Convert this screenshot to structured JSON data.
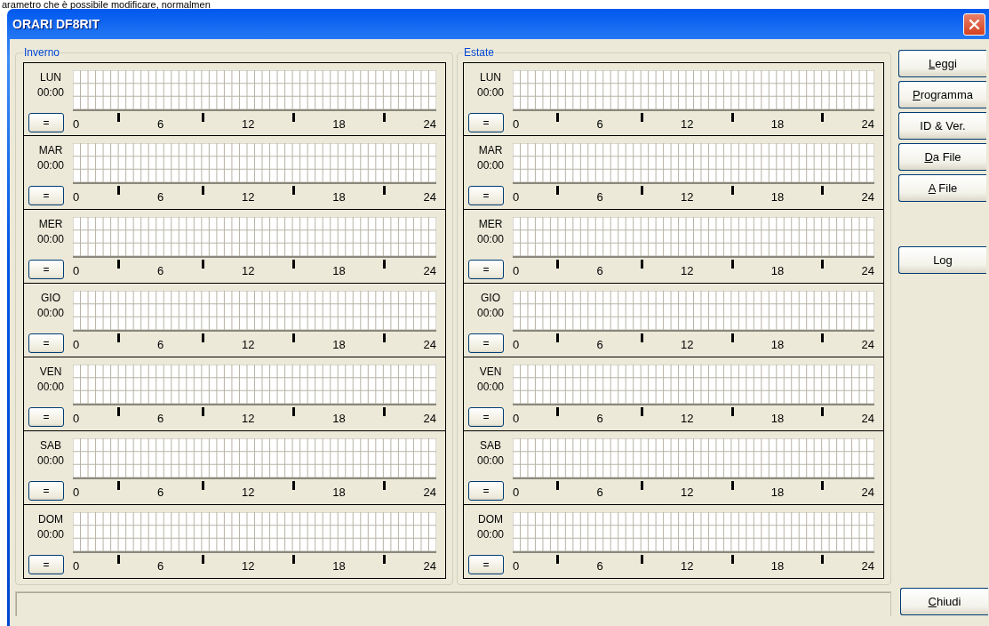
{
  "page_text": "arametro che è possibile modificare, normalmen",
  "window": {
    "title": "ORARI DF8RIT"
  },
  "groups": [
    {
      "title": "Inverno",
      "days": [
        {
          "day": "LUN",
          "time": "00:00",
          "button": "=",
          "scale": [
            "0",
            "6",
            "12",
            "18",
            "24"
          ]
        },
        {
          "day": "MAR",
          "time": "00:00",
          "button": "=",
          "scale": [
            "0",
            "6",
            "12",
            "18",
            "24"
          ]
        },
        {
          "day": "MER",
          "time": "00:00",
          "button": "=",
          "scale": [
            "0",
            "6",
            "12",
            "18",
            "24"
          ]
        },
        {
          "day": "GIO",
          "time": "00:00",
          "button": "=",
          "scale": [
            "0",
            "6",
            "12",
            "18",
            "24"
          ]
        },
        {
          "day": "VEN",
          "time": "00:00",
          "button": "=",
          "scale": [
            "0",
            "6",
            "12",
            "18",
            "24"
          ]
        },
        {
          "day": "SAB",
          "time": "00:00",
          "button": "=",
          "scale": [
            "0",
            "6",
            "12",
            "18",
            "24"
          ]
        },
        {
          "day": "DOM",
          "time": "00:00",
          "button": "=",
          "scale": [
            "0",
            "6",
            "12",
            "18",
            "24"
          ]
        }
      ]
    },
    {
      "title": "Estate",
      "days": [
        {
          "day": "LUN",
          "time": "00:00",
          "button": "=",
          "scale": [
            "0",
            "6",
            "12",
            "18",
            "24"
          ]
        },
        {
          "day": "MAR",
          "time": "00:00",
          "button": "=",
          "scale": [
            "0",
            "6",
            "12",
            "18",
            "24"
          ]
        },
        {
          "day": "MER",
          "time": "00:00",
          "button": "=",
          "scale": [
            "0",
            "6",
            "12",
            "18",
            "24"
          ]
        },
        {
          "day": "GIO",
          "time": "00:00",
          "button": "=",
          "scale": [
            "0",
            "6",
            "12",
            "18",
            "24"
          ]
        },
        {
          "day": "VEN",
          "time": "00:00",
          "button": "=",
          "scale": [
            "0",
            "6",
            "12",
            "18",
            "24"
          ]
        },
        {
          "day": "SAB",
          "time": "00:00",
          "button": "=",
          "scale": [
            "0",
            "6",
            "12",
            "18",
            "24"
          ]
        },
        {
          "day": "DOM",
          "time": "00:00",
          "button": "=",
          "scale": [
            "0",
            "6",
            "12",
            "18",
            "24"
          ]
        }
      ]
    }
  ],
  "button_groups": [
    [
      {
        "mnemonic": "L",
        "rest": "eggi"
      },
      {
        "mnemonic": "P",
        "rest": "rogramma"
      },
      {
        "text": "ID & Ver."
      },
      {
        "mnemonic": "D",
        "rest": "a File"
      },
      {
        "mnemonic": "A",
        "rest": " File"
      }
    ],
    [
      {
        "text": "Log"
      }
    ]
  ],
  "close_button": {
    "mnemonic": "C",
    "rest": "hiudi"
  }
}
